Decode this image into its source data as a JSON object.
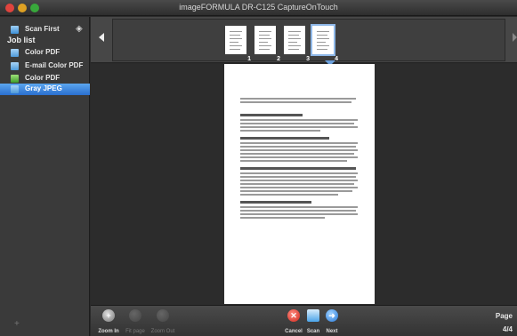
{
  "window": {
    "title": "imageFORMULA DR-C125 CaptureOnTouch"
  },
  "sidebar": {
    "scan_first": "Scan First",
    "job_list_label": "Job list",
    "jobs": [
      {
        "label": "Color PDF",
        "icon": "folder-icon"
      },
      {
        "label": "E-mail Color PDF",
        "icon": "folder-icon"
      },
      {
        "label": "Color PDF",
        "icon": "green-document-icon"
      },
      {
        "label": "Gray JPEG",
        "icon": "folder-icon",
        "selected": true
      }
    ],
    "add_glyph": "+"
  },
  "thumbnails": {
    "pages": [
      {
        "num": "1"
      },
      {
        "num": "2"
      },
      {
        "num": "3"
      },
      {
        "num": "4",
        "selected": true
      }
    ]
  },
  "toolbar": {
    "zoom_in": "Zoom In",
    "fit_page": "Fit page",
    "zoom_out": "Zoom Out",
    "cancel": "Cancel",
    "scan": "Scan",
    "next": "Next",
    "page_label": "Page",
    "page_count": "4/4"
  },
  "colors": {
    "accent": "#2a6fcf",
    "sidebar_bg": "#3a3a3a",
    "viewer_bg": "#2c2c2c"
  }
}
